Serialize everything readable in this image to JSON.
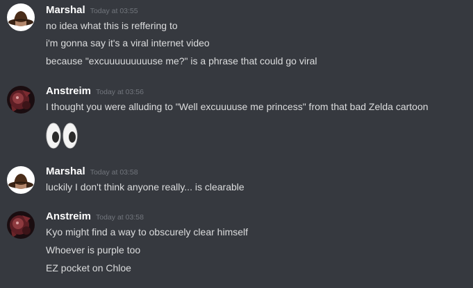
{
  "colors": {
    "background": "#36393f",
    "username": "#ffffff",
    "timestamp": "#72767d",
    "message_text": "#dcddde"
  },
  "messages": [
    {
      "author": "Marshal",
      "avatar": "cowboy-hat-avatar",
      "timestamp": "Today at 03:55",
      "lines": [
        "no idea what this is reffering to",
        "i'm gonna say it's a viral internet video",
        "because \"excuuuuuuuuuse me?\" is a phrase that could go viral"
      ]
    },
    {
      "author": "Anstreim",
      "avatar": "red-creature-avatar",
      "timestamp": "Today at 03:56",
      "lines": [
        "I thought you were alluding to \"Well excuuuuse me princess\" from that bad Zelda cartoon"
      ],
      "emoji": "eyes-emoji"
    },
    {
      "author": "Marshal",
      "avatar": "cowboy-hat-avatar",
      "timestamp": "Today at 03:58",
      "lines": [
        "luckily I don't think anyone really... is clearable"
      ]
    },
    {
      "author": "Anstreim",
      "avatar": "red-creature-avatar",
      "timestamp": "Today at 03:58",
      "lines": [
        "Kyo might find a way to obscurely clear himself",
        "Whoever is purple too",
        "EZ pocket on Chloe"
      ]
    }
  ]
}
